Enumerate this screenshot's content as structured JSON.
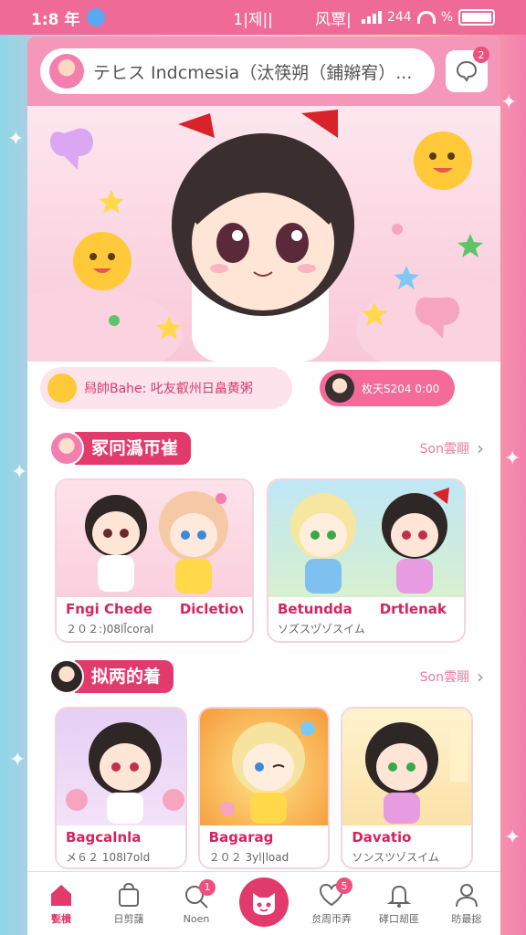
{
  "status_bar": {
    "time": "1:8 年",
    "mid": "1|제||",
    "mid2": "风覃|",
    "battery_text": "244",
    "wifi_pct": "%"
  },
  "search": {
    "placeholder": "テヒス Indcmesia（汰筷朔（鋪辮宥）..."
  },
  "messages": {
    "badge": "2"
  },
  "ticker": {
    "text": "舄帥Bahe: 叱友叡州日畠黄粥"
  },
  "live": {
    "text": "枚天S204 0:00"
  },
  "section1": {
    "title": "冢冋潙帀崔",
    "more": "Son雲翢",
    "cards": [
      {
        "title_a": "Fngi Chede",
        "title_b": "Dicletiov",
        "subtitle": "２０２:)08ll̃coral"
      },
      {
        "title_a": "Betundda",
        "title_b": "Drtlenak",
        "subtitle": "ソズスツ゚ゾスイム"
      }
    ]
  },
  "section2": {
    "title": "拟两的着",
    "more": "Son雲翢",
    "cards": [
      {
        "title": "Bagcalnla",
        "subtitle": "メ６２ 108I7old"
      },
      {
        "title": "Bagarag",
        "subtitle": "２０２ 3yl|load"
      },
      {
        "title": "Davatio",
        "subtitle": "ソンスツゾスイム"
      }
    ]
  },
  "bottom_nav": [
    {
      "label": "甏樻",
      "active": true
    },
    {
      "label": "日剪藷",
      "active": false
    },
    {
      "label": "Noen",
      "badge": "1",
      "active": false
    },
    {
      "label": "",
      "center": true,
      "active": false
    },
    {
      "label": "贠周帀弄",
      "badge": "5",
      "active": false
    },
    {
      "label": "硣口刼匪",
      "active": false
    },
    {
      "label": "昉最捴",
      "active": false
    }
  ],
  "colors": {
    "accent": "#e23a6c",
    "topbar": "#f497b8",
    "status": "#f06a98"
  }
}
